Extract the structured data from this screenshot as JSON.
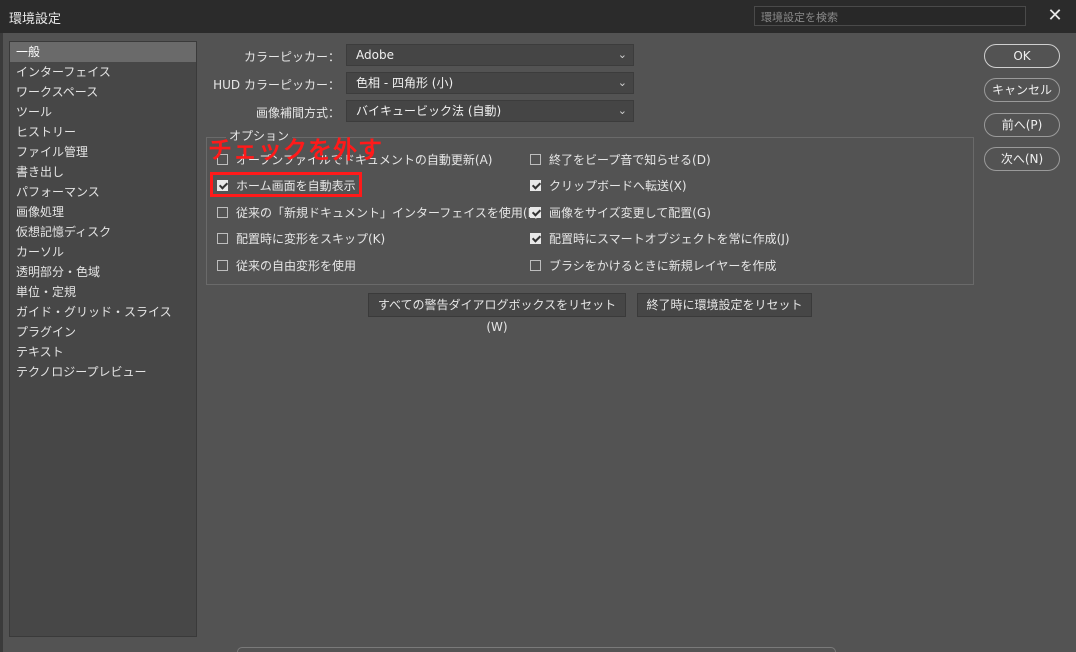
{
  "window": {
    "title": "環境設定",
    "search_placeholder": "環境設定を検索",
    "close": "✕"
  },
  "sidebar": {
    "items": [
      {
        "label": "一般",
        "selected": true
      },
      {
        "label": "インターフェイス"
      },
      {
        "label": "ワークスペース"
      },
      {
        "label": "ツール"
      },
      {
        "label": "ヒストリー"
      },
      {
        "label": "ファイル管理"
      },
      {
        "label": "書き出し"
      },
      {
        "label": "パフォーマンス"
      },
      {
        "label": "画像処理"
      },
      {
        "label": "仮想記憶ディスク"
      },
      {
        "label": "カーソル"
      },
      {
        "label": "透明部分・色域"
      },
      {
        "label": "単位・定規"
      },
      {
        "label": "ガイド・グリッド・スライス"
      },
      {
        "label": "プラグイン"
      },
      {
        "label": "テキスト"
      },
      {
        "label": "テクノロジープレビュー"
      }
    ]
  },
  "general": {
    "color_picker_label": "カラーピッカー：",
    "color_picker_value": "Adobe",
    "hud_picker_label": "HUD カラーピッカー：",
    "hud_picker_value": "色相 - 四角形 (小)",
    "interpolation_label": "画像補間方式：",
    "interpolation_value": "バイキュービック法 (自動)"
  },
  "options": {
    "legend": "オプション",
    "left": [
      {
        "label": "オープンファイルでドキュメントの自動更新(A)",
        "checked": false
      },
      {
        "label": "ホーム画面を自動表示",
        "checked": true
      },
      {
        "label": "従来の「新規ドキュメント」インターフェイスを使用(L)",
        "checked": false
      },
      {
        "label": "配置時に変形をスキップ(K)",
        "checked": false
      },
      {
        "label": "従来の自由変形を使用",
        "checked": false
      }
    ],
    "right": [
      {
        "label": "終了をビープ音で知らせる(D)",
        "checked": false
      },
      {
        "label": "クリップボードへ転送(X)",
        "checked": true
      },
      {
        "label": "画像をサイズ変更して配置(G)",
        "checked": true
      },
      {
        "label": "配置時にスマートオブジェクトを常に作成(J)",
        "checked": true
      },
      {
        "label": "ブラシをかけるときに新規レイヤーを作成",
        "checked": false
      }
    ]
  },
  "annotation": {
    "text": "チェックを外す",
    "color": "#ff1a1a"
  },
  "buttons": {
    "reset_warnings": "すべての警告ダイアログボックスをリセット (W)",
    "reset_on_quit": "終了時に環境設定をリセット",
    "ok": "OK",
    "cancel": "キャンセル",
    "prev": "前へ(P)",
    "next": "次へ(N)"
  },
  "colors": {
    "dialog_bg": "#535353",
    "titlebar_bg": "#2b2b2b",
    "sidebar_selected": "#6a6a6a"
  }
}
